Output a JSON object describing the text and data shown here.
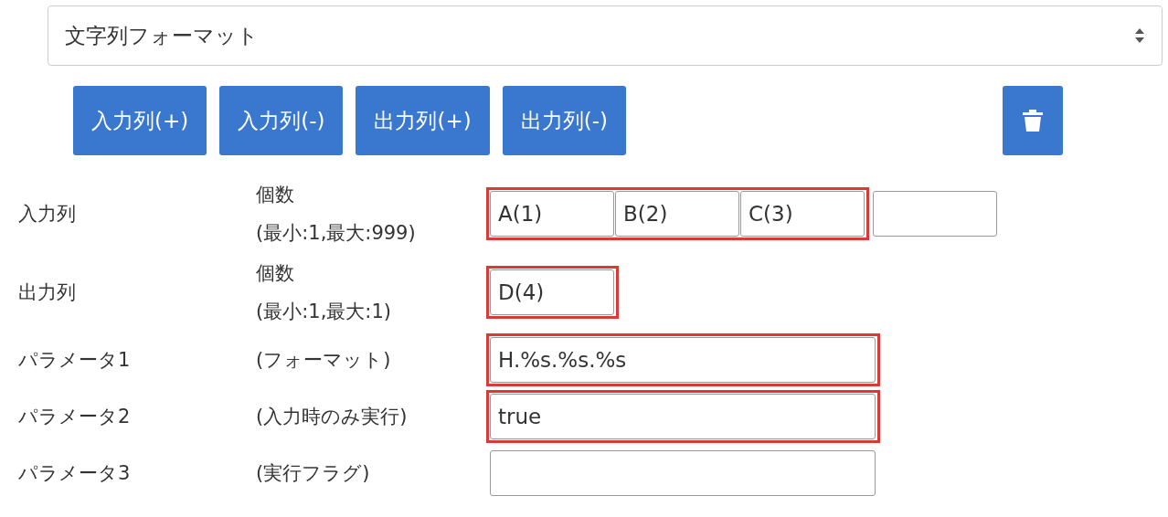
{
  "select": {
    "value": "文字列フォーマット"
  },
  "buttons": [
    {
      "label": "入力列(+)"
    },
    {
      "label": "入力列(-)"
    },
    {
      "label": "出力列(+)"
    },
    {
      "label": "出力列(-)"
    }
  ],
  "rows": [
    {
      "label": "入力列",
      "description": [
        "個数",
        "(最小:1,最大:999)"
      ],
      "groups": [
        {
          "highlighted": true,
          "fields": [
            {
              "kind": "text",
              "value": "A(1)"
            },
            {
              "kind": "text",
              "value": "B(2)"
            },
            {
              "kind": "text",
              "value": "C(3)"
            }
          ]
        },
        {
          "highlighted": false,
          "fields": [
            {
              "kind": "blank"
            }
          ]
        }
      ]
    },
    {
      "label": "出力列",
      "description": [
        "個数",
        "(最小:1,最大:1)"
      ],
      "groups": [
        {
          "highlighted": true,
          "fields": [
            {
              "kind": "text",
              "value": "D(4)"
            }
          ]
        }
      ]
    },
    {
      "label": "パラメータ1",
      "description": [
        "(フォーマット)"
      ],
      "groups": [
        {
          "highlighted": true,
          "fields": [
            {
              "kind": "text",
              "value": "H.%s.%s.%s"
            }
          ]
        }
      ]
    },
    {
      "label": "パラメータ2",
      "description": [
        "(入力時のみ実行)"
      ],
      "groups": [
        {
          "highlighted": true,
          "fields": [
            {
              "kind": "text",
              "value": "true"
            }
          ]
        }
      ]
    },
    {
      "label": "パラメータ3",
      "description": [
        "(実行フラグ)"
      ],
      "groups": [
        {
          "highlighted": false,
          "fields": [
            {
              "kind": "blank"
            }
          ]
        }
      ]
    }
  ]
}
